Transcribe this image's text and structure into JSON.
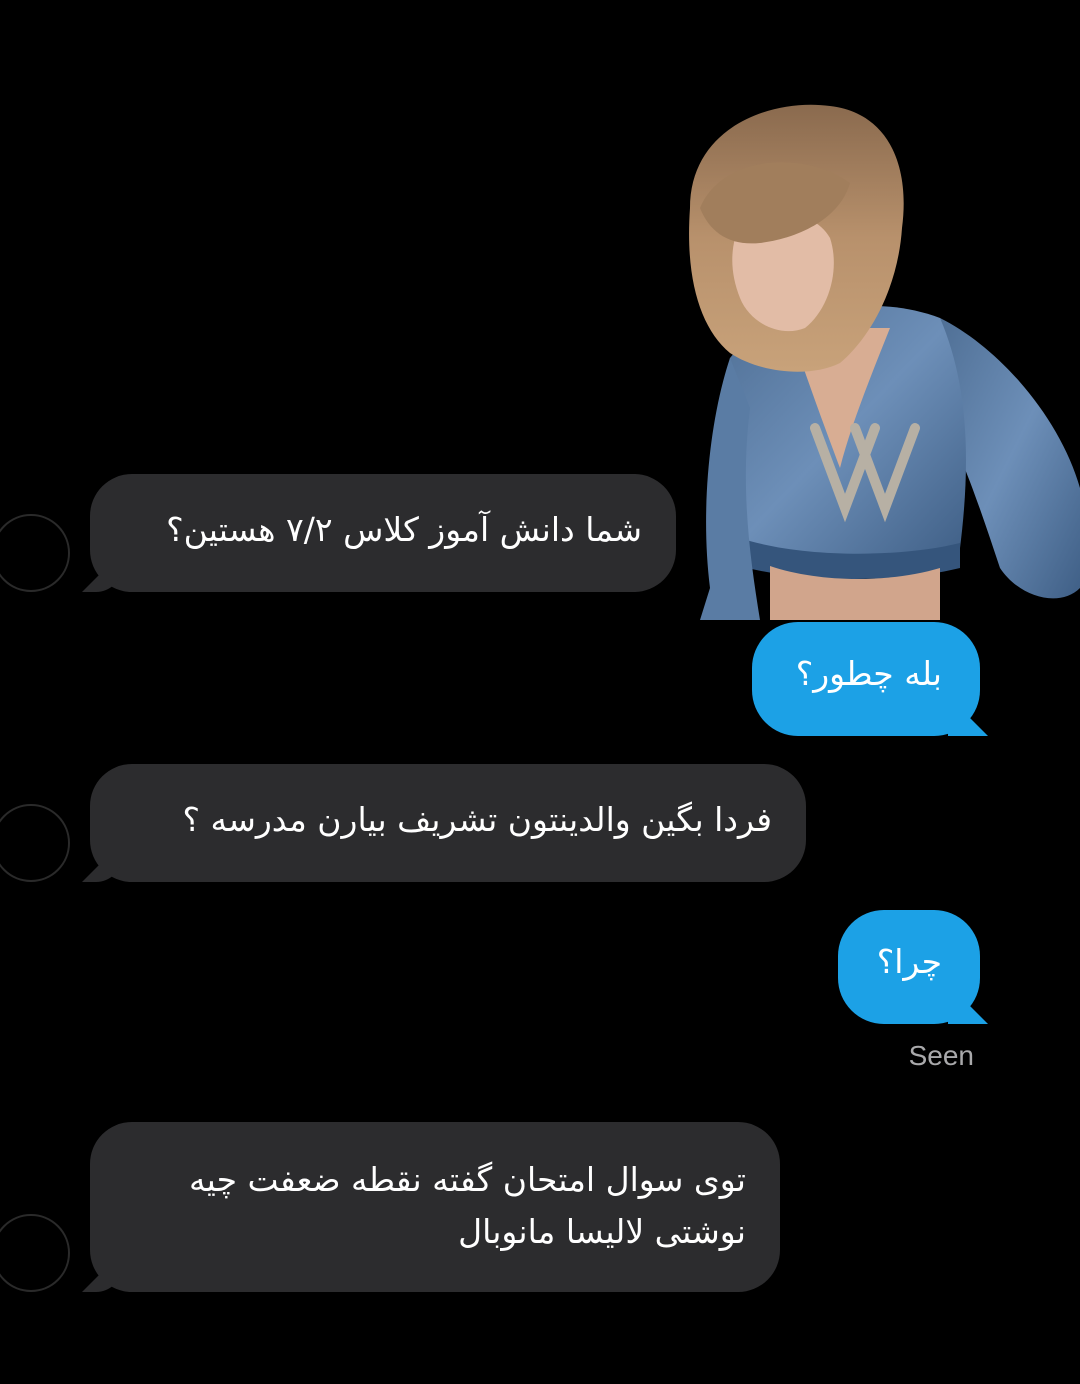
{
  "messages": [
    {
      "sender": "them",
      "text": "شما دانش آموز کلاس ۷/۲ هستین؟"
    },
    {
      "sender": "me",
      "text": "بله چطور؟"
    },
    {
      "sender": "them",
      "text": "فردا بگین والدینتون تشریف بیارن مدرسه ؟"
    },
    {
      "sender": "me",
      "text": "چرا؟"
    },
    {
      "sender": "them",
      "line1": "توی سوال امتحان گفته نقطه ضعفت چیه",
      "line2": "نوشتی لالیسا مانوبال"
    }
  ],
  "status": {
    "seen_label": "Seen"
  },
  "colors": {
    "background": "#000000",
    "incoming_bubble": "#2c2c2e",
    "outgoing_bubble": "#1ca1e6",
    "seen_text": "#a9a9ab"
  },
  "sticker": {
    "description_icon": "person-photo-sticker"
  }
}
